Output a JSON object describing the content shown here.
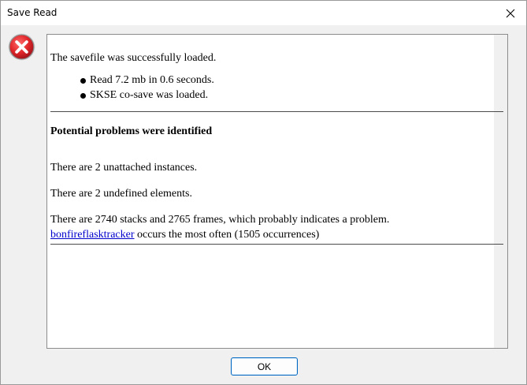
{
  "window": {
    "title": "Save Read",
    "close_icon": "close-icon",
    "error_icon": "error-icon",
    "error_color": "#e0262a"
  },
  "report": {
    "loaded_text": "The savefile was successfully loaded.",
    "bullets": [
      "Read 7.2 mb in 0.6 seconds.",
      "SKSE co-save was loaded."
    ],
    "problems_heading": "Potential problems were identified",
    "unattached": "There are 2 unattached instances.",
    "undefined": "There are 2 undefined elements.",
    "stacks": "There are 2740 stacks and 2765 frames, which probably indicates a problem.",
    "link_text": "bonfireflasktracker",
    "link_suffix": " occurs the most often (1505 occurrences)"
  },
  "buttons": {
    "ok_label": "OK"
  }
}
